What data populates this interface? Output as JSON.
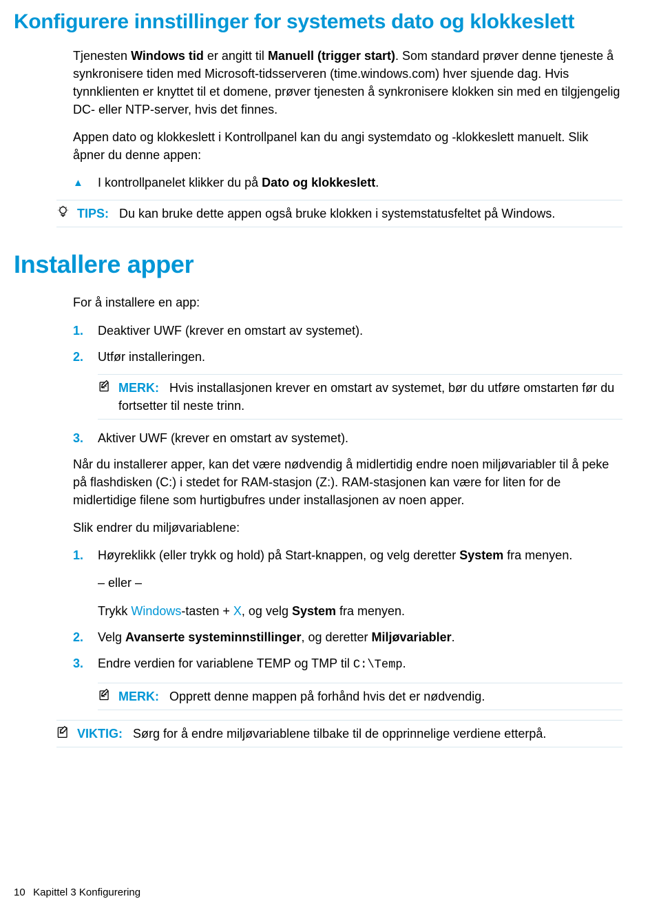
{
  "h1": "Konfigurere innstillinger for systemets dato og klokkeslett",
  "p1a": "Tjenesten ",
  "p1b": "Windows tid",
  "p1c": " er angitt til ",
  "p1d": "Manuell (trigger start)",
  "p1e": ". Som standard prøver denne tjeneste å synkronisere tiden med Microsoft-tidsserveren (time.windows.com) hver sjuende dag. Hvis tynnklienten er knyttet til et domene, prøver tjenesten å synkronisere klokken sin med en tilgjengelig DC- eller NTP-server, hvis det finnes.",
  "p2": "Appen dato og klokkeslett i Kontrollpanel kan du angi systemdato og -klokkeslett manuelt. Slik åpner du denne appen:",
  "b1a": "I kontrollpanelet klikker du på ",
  "b1b": "Dato og klokkeslett",
  "b1c": ".",
  "tips_label": "TIPS:",
  "tips_body": "Du kan bruke dette appen også bruke klokken i systemstatusfeltet på Windows.",
  "h2": "Installere apper",
  "p3": "For å installere en app:",
  "n1": "1.",
  "n1t": "Deaktiver UWF (krever en omstart av systemet).",
  "n2": "2.",
  "n2t": "Utfør installeringen.",
  "merk_label": "MERK:",
  "merk1": "Hvis installasjonen krever en omstart av systemet, bør du utføre omstarten før du fortsetter til neste trinn.",
  "n3": "3.",
  "n3t": "Aktiver UWF (krever en omstart av systemet).",
  "p4": "Når du installerer apper, kan det være nødvendig å midlertidig endre noen miljøvariabler til å peke på flashdisken (C:) i stedet for RAM-stasjon (Z:). RAM-stasjonen kan være for liten for de midlertidige filene som hurtigbufres under installasjonen av noen apper.",
  "p5": "Slik endrer du miljøvariablene:",
  "m1": "1.",
  "m1a": "Høyreklikk (eller trykk og hold) på Start-knappen, og velg deretter ",
  "m1b": "System",
  "m1c": " fra menyen.",
  "m1d": "– eller –",
  "m1e1": "Trykk ",
  "m1e2": "Windows",
  "m1e3": "-tasten + ",
  "m1e4": "X",
  "m1e5": ", og velg ",
  "m1e6": "System",
  "m1e7": " fra menyen.",
  "m2": "2.",
  "m2a": "Velg ",
  "m2b": "Avanserte systeminnstillinger",
  "m2c": ", og deretter ",
  "m2d": "Miljøvariabler",
  "m2e": ".",
  "m3": "3.",
  "m3a": "Endre verdien for variablene TEMP og TMP til ",
  "m3b": "C:\\Temp",
  "m3c": ".",
  "merk2": "Opprett denne mappen på forhånd hvis det er nødvendig.",
  "viktig_label": "VIKTIG:",
  "viktig": "Sørg for å endre miljøvariablene tilbake til de opprinnelige verdiene etterpå.",
  "footer_page": "10",
  "footer_chap": "Kapittel 3   Konfigurering"
}
